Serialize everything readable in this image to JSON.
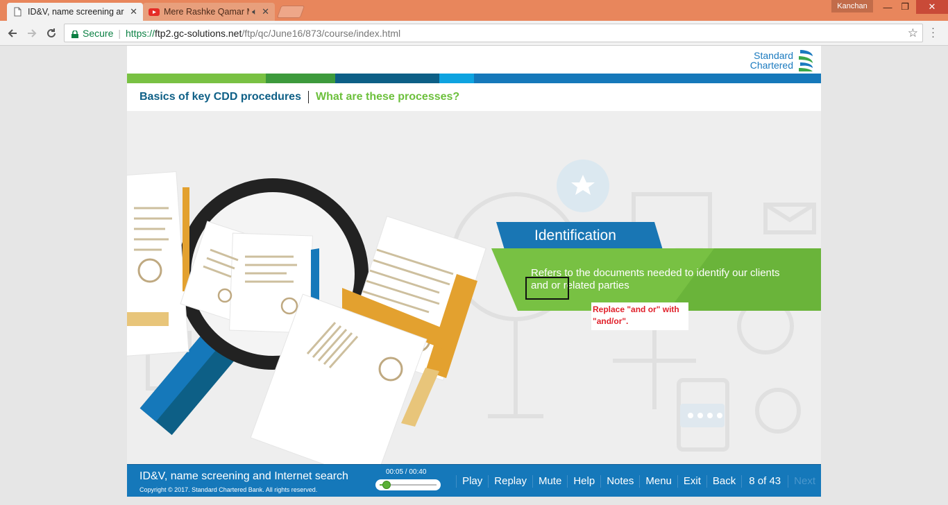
{
  "browser": {
    "tabs": [
      {
        "title": "ID&V, name screening ar",
        "active": true,
        "icon": "page-icon"
      },
      {
        "title": "Mere Rashke Qamar M",
        "active": false,
        "icon": "youtube-icon",
        "audio": true
      }
    ],
    "user": "Kanchan",
    "secure_label": "Secure",
    "url": {
      "scheme": "https://",
      "host": "ftp2.gc-solutions.net",
      "path": "/ftp/qc/June16/873/course/index.html"
    }
  },
  "course": {
    "logo": {
      "line1": "Standard",
      "line2": "Chartered"
    },
    "breadcrumb": {
      "section": "Basics of key CDD procedures",
      "topic": "What are these processes?"
    },
    "card": {
      "title": "Identification",
      "body_line1": "Refers to the documents needed to identify our clients",
      "body_line2": "and or related parties"
    },
    "review_note": {
      "line1": "Replace \"and or\" with",
      "line2": "\"and/or\"."
    },
    "footer": {
      "title": "ID&V, name screening and Internet search",
      "copyright": "Copyright © 2017. Standard Chartered Bank. All rights reserved.",
      "time": "00:05 / 00:40",
      "progress": 0.125,
      "buttons": {
        "play": "Play",
        "replay": "Replay",
        "mute": "Mute",
        "help": "Help",
        "notes": "Notes",
        "menu": "Menu",
        "exit": "Exit",
        "back": "Back",
        "page": "8 of 43",
        "next": "Next"
      }
    }
  },
  "colors": {
    "stripe": [
      "#79c143",
      "#3d9a3c",
      "#0d5f86",
      "#0ea3e0",
      "#1578ba"
    ],
    "brand_blue": "#1578ba",
    "brand_green": "#78c143"
  }
}
